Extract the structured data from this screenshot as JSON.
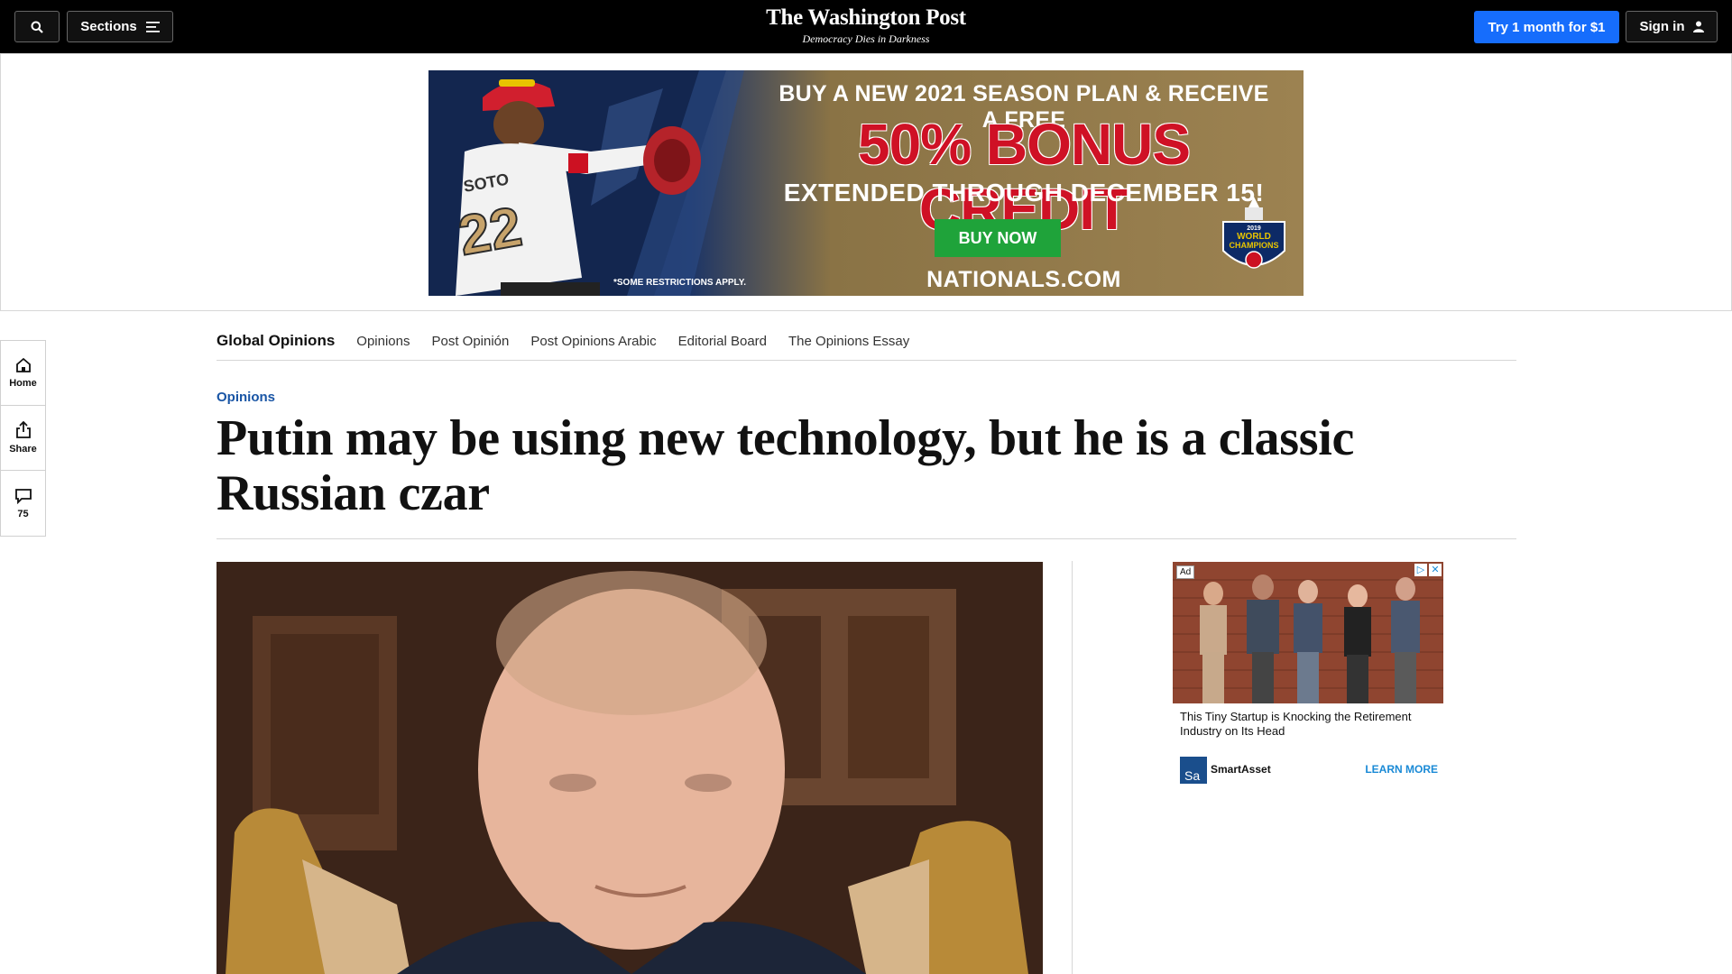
{
  "topbar": {
    "sections_label": "Sections",
    "logo": "The Washington Post",
    "tagline": "Democracy Dies in Darkness",
    "subscribe_label": "Try 1 month for $1",
    "signin_label": "Sign in"
  },
  "banner_ad": {
    "line1": "BUY A NEW 2021 SEASON PLAN & RECEIVE A FREE",
    "line2": "50% BONUS CREDIT",
    "line3": "EXTENDED THROUGH DECEMBER 15!",
    "cta": "BUY NOW",
    "domain": "NATIONALS.COM",
    "restrictions": "*SOME RESTRICTIONS APPLY.",
    "badge_year": "2019",
    "badge_line1": "WORLD",
    "badge_line2": "CHAMPIONS",
    "jersey_name": "SOTO",
    "jersey_number": "22"
  },
  "rail": {
    "home_label": "Home",
    "share_label": "Share",
    "comments_count": "75"
  },
  "section_nav": {
    "brand": "Global Opinions",
    "links": [
      "Opinions",
      "Post Opinión",
      "Post Opinions Arabic",
      "Editorial Board",
      "The Opinions Essay"
    ]
  },
  "article": {
    "kicker": "Opinions",
    "headline": "Putin may be using new technology, but he is a classic Russian czar"
  },
  "side_ad": {
    "tag": "Ad",
    "title": "This Tiny Startup is Knocking the Retirement Industry on Its Head",
    "sponsor_initials": "Sa",
    "sponsor": "SmartAsset",
    "cta": "LEARN MORE"
  },
  "colors": {
    "accent_blue": "#166dfc",
    "kicker_blue": "#1955a5",
    "nats_red": "#cf1125",
    "cta_green": "#1fa33a"
  }
}
